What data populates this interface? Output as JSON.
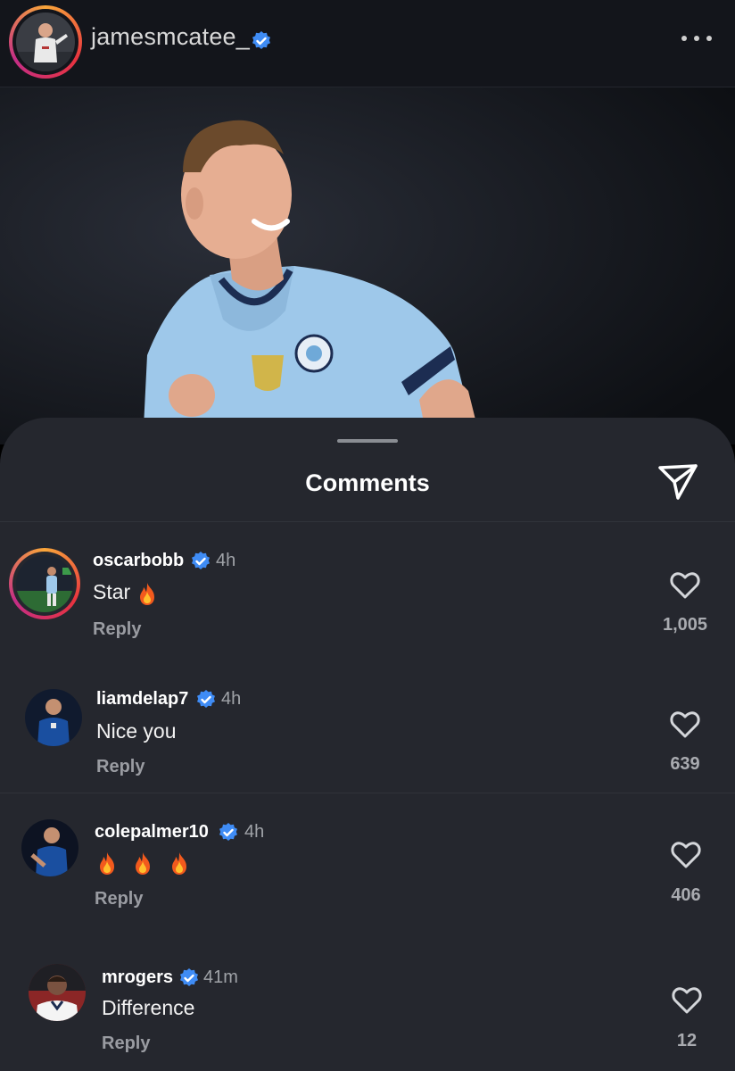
{
  "post": {
    "username": "jamesmcatee_",
    "verified": true,
    "more_icon": "more-horizontal-icon"
  },
  "sheet": {
    "title": "Comments",
    "share_icon": "paper-plane-icon"
  },
  "comments": [
    {
      "username": "oscarbobb",
      "verified": true,
      "time": "4h",
      "text": "Star",
      "emoji": "fire",
      "reply_label": "Reply",
      "likes": "1,005",
      "has_story": true
    },
    {
      "username": "liamdelap7",
      "verified": true,
      "time": "4h",
      "text": "Nice you",
      "reply_label": "Reply",
      "likes": "639",
      "has_story": false
    },
    {
      "username": "colepalmer10",
      "verified": true,
      "time": "4h",
      "text": "",
      "emoji": "fire fire fire",
      "reply_label": "Reply",
      "likes": "406",
      "has_story": false
    },
    {
      "username": "mrogers",
      "verified": true,
      "time": "41m",
      "text": "Difference",
      "reply_label": "Reply",
      "likes": "12",
      "has_story": false
    }
  ],
  "colors": {
    "verified": "#3f8cf5",
    "sheet_bg": "#25272e",
    "header_bg": "#13151b",
    "jersey": "#9ec8ea"
  }
}
